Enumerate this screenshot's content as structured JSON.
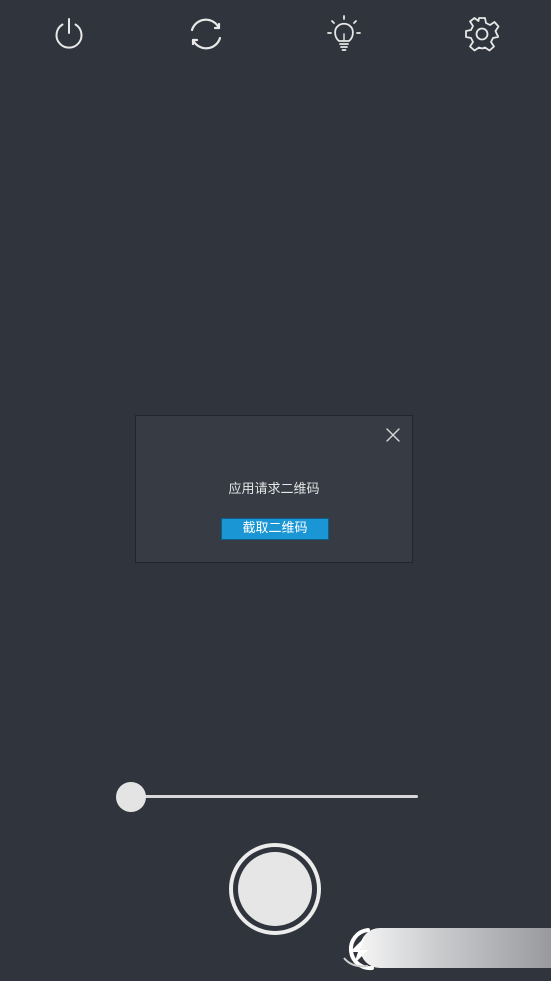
{
  "toolbar": {
    "power_icon": "power-icon",
    "switch_icon": "switch-camera-icon",
    "light_icon": "lightbulb-icon",
    "settings_icon": "gear-icon"
  },
  "dialog": {
    "message": "应用请求二维码",
    "action_label": "截取二维码",
    "close_icon": "close-icon"
  },
  "zoom_slider": {
    "value": 0
  },
  "colors": {
    "background": "#30343c",
    "dialog_background": "#373b44",
    "accent": "#1a96d4",
    "foreground": "#e6e6e6"
  }
}
